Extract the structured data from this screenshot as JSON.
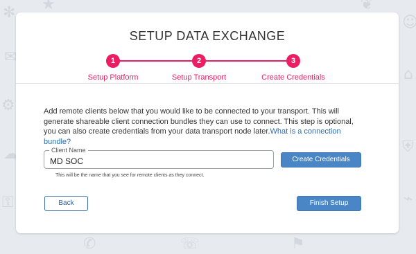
{
  "title": "SETUP DATA EXCHANGE",
  "steps": [
    {
      "number": "1",
      "label": "Setup Platform"
    },
    {
      "number": "2",
      "label": "Setup Transport"
    },
    {
      "number": "3",
      "label": "Create Credentials"
    }
  ],
  "description": {
    "text": "Add remote clients below that you would like to be connected to your transport. This will generate shareable client connection bundles they can use to connect. This step is optional, you can also create credentials from your data transport node later.",
    "link_text": "What is a connection bundle?"
  },
  "client_field": {
    "legend": "Client Name",
    "value": "MD SOC"
  },
  "create_button_label": "Create Credentials",
  "hint": "This will be the name that you see for remote clients as they connect.",
  "back_button_label": "Back",
  "finish_button_label": "Finish Setup",
  "colors": {
    "accent": "#e91e63",
    "primary_button": "#4a86c5",
    "background": "#e7eaee",
    "link": "#2b6cb0"
  },
  "background_icons": [
    "person-icon",
    "chat-icon",
    "shield-icon",
    "gear-icon",
    "cloud-icon",
    "globe-icon",
    "code-icon",
    "wifi-icon",
    "mail-icon",
    "lock-icon",
    "document-icon",
    "user-icon"
  ]
}
